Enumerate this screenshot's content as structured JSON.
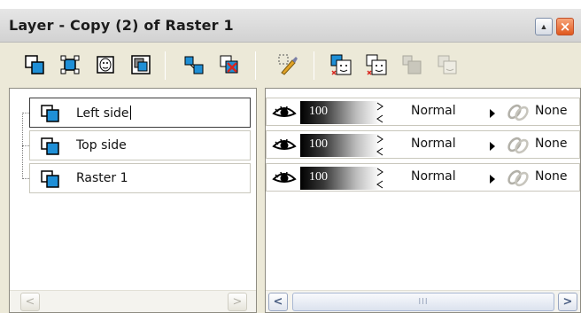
{
  "window": {
    "title": "Layer - Copy (2) of Raster 1",
    "restore_label": "▲",
    "close_label": "×"
  },
  "toolbar": {
    "tools": [
      {
        "icon": "new-raster-layer-icon"
      },
      {
        "icon": "new-vector-layer-icon"
      },
      {
        "icon": "new-mask-layer-icon"
      },
      {
        "icon": "new-layer-group-icon"
      },
      {
        "icon": "duplicate-layer-icon"
      },
      {
        "icon": "delete-layer-icon"
      },
      {
        "icon": "edit-selection-icon"
      },
      {
        "icon": "show-mask-icon"
      },
      {
        "icon": "mask-overlay-icon"
      },
      {
        "icon": "link-mask-icon"
      },
      {
        "icon": "mask-properties-icon"
      }
    ]
  },
  "layers": [
    {
      "name": "Left side",
      "editing": true,
      "opacity": "100",
      "blend_mode": "Normal",
      "link": "None"
    },
    {
      "name": "Top side",
      "editing": false,
      "opacity": "100",
      "blend_mode": "Normal",
      "link": "None"
    },
    {
      "name": "Raster 1",
      "editing": false,
      "opacity": "100",
      "blend_mode": "Normal",
      "link": "None"
    }
  ],
  "scrollbars": {
    "left": {
      "prev": "<",
      "next": ">"
    },
    "right": {
      "prev": "<",
      "next": ">",
      "thumb": "III"
    }
  },
  "colors": {
    "panel": "#ece9d8",
    "layer_icon": "#1f8fd6",
    "close_button": "#e0591e"
  }
}
